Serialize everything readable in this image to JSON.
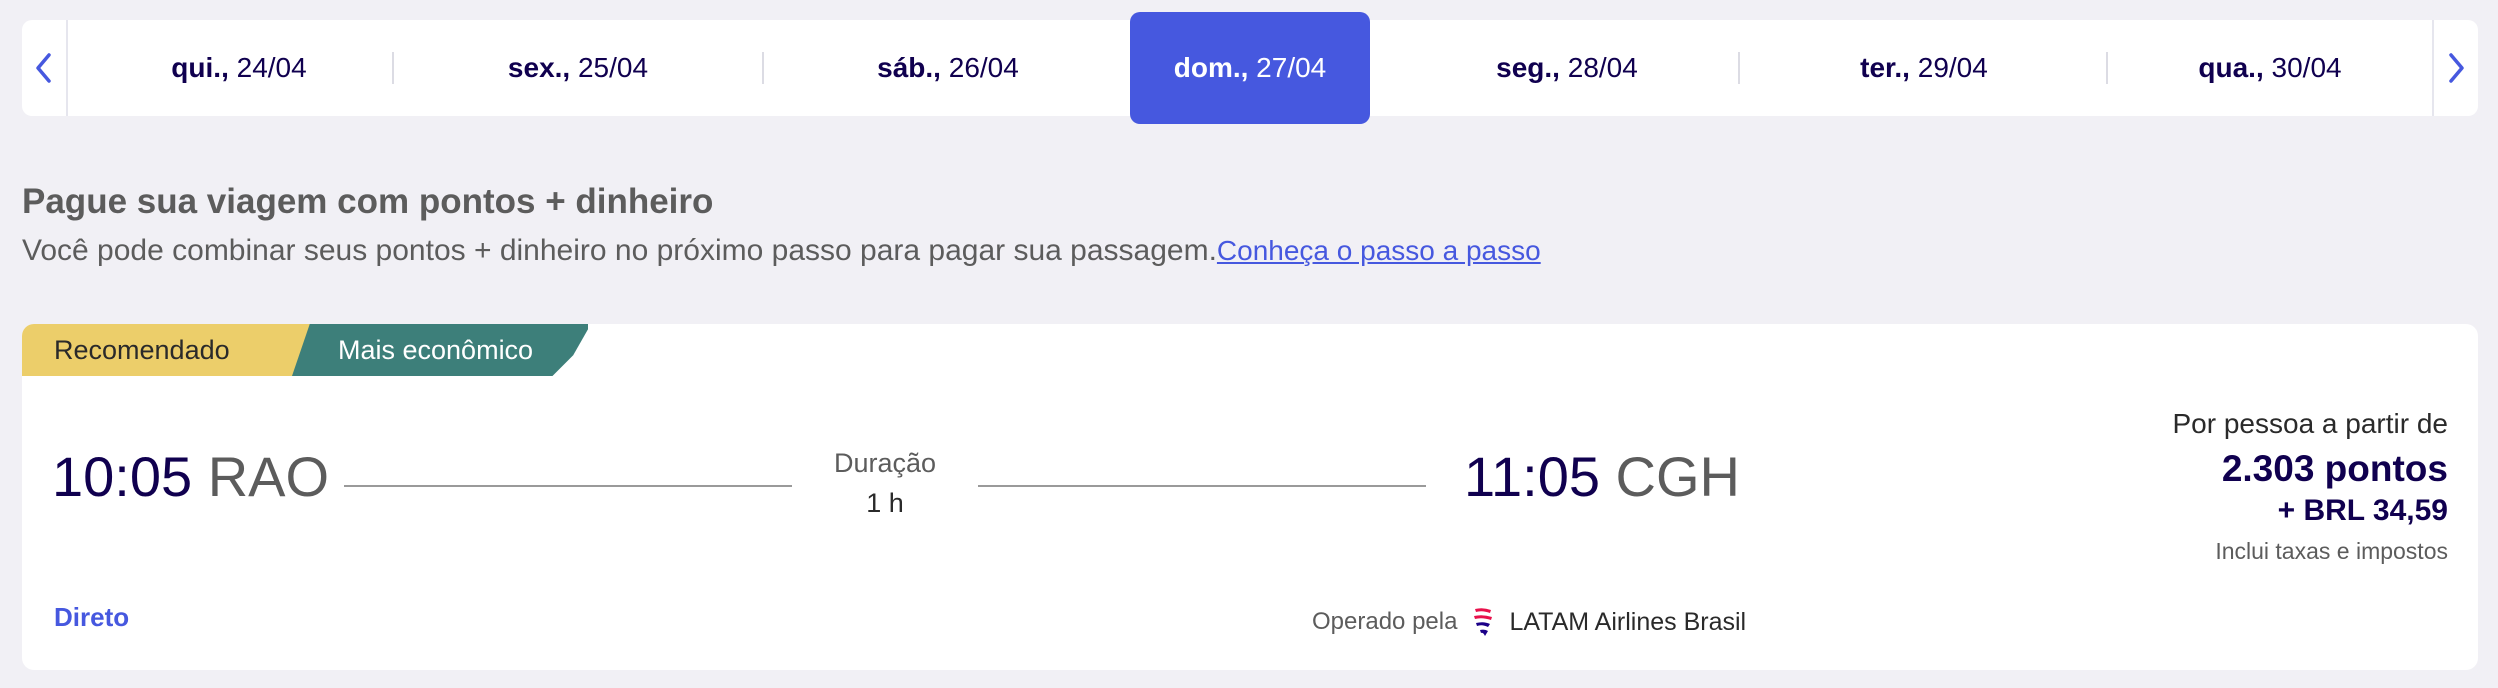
{
  "datebar": {
    "prev_icon": "chevron-left-icon",
    "next_icon": "chevron-right-icon",
    "days": [
      {
        "weekday": "qui.,",
        "date": " 24/04"
      },
      {
        "weekday": "sex.,",
        "date": " 25/04"
      },
      {
        "weekday": "sáb.,",
        "date": " 26/04"
      },
      {
        "weekday": "dom.,",
        "date": " 27/04"
      },
      {
        "weekday": "seg.,",
        "date": " 28/04"
      },
      {
        "weekday": "ter.,",
        "date": " 29/04"
      },
      {
        "weekday": "qua.,",
        "date": " 30/04"
      }
    ],
    "selected_index": 3
  },
  "promo": {
    "title": "Pague sua viagem com pontos + dinheiro",
    "description": "Você pode combinar seus pontos + dinheiro no próximo passo para pagar sua passagem.",
    "link": "Conheça o passo a passo"
  },
  "flight": {
    "tags": {
      "recommended": "Recomendado",
      "cheapest": "Mais econômico"
    },
    "departure": {
      "time": "10:05",
      "code": "RAO"
    },
    "arrival": {
      "time": "11:05",
      "code": "CGH"
    },
    "duration_label": "Duração",
    "duration_value": "1 h",
    "stops": "Direto",
    "operated_label": "Operado pela",
    "airline_icon": "latam-logo-icon",
    "airline": "LATAM Airlines Brasil",
    "price": {
      "from_label": "Por pessoa a partir de",
      "points": "2.303 pontos",
      "cash": "+ BRL 34,59",
      "taxes_note": "Inclui taxas e impostos"
    }
  },
  "colors": {
    "accent": "#4658df",
    "navy": "#10004f",
    "tag_yellow": "#ecce6a",
    "tag_teal": "#3d7f7a",
    "background": "#f1f0f5"
  }
}
